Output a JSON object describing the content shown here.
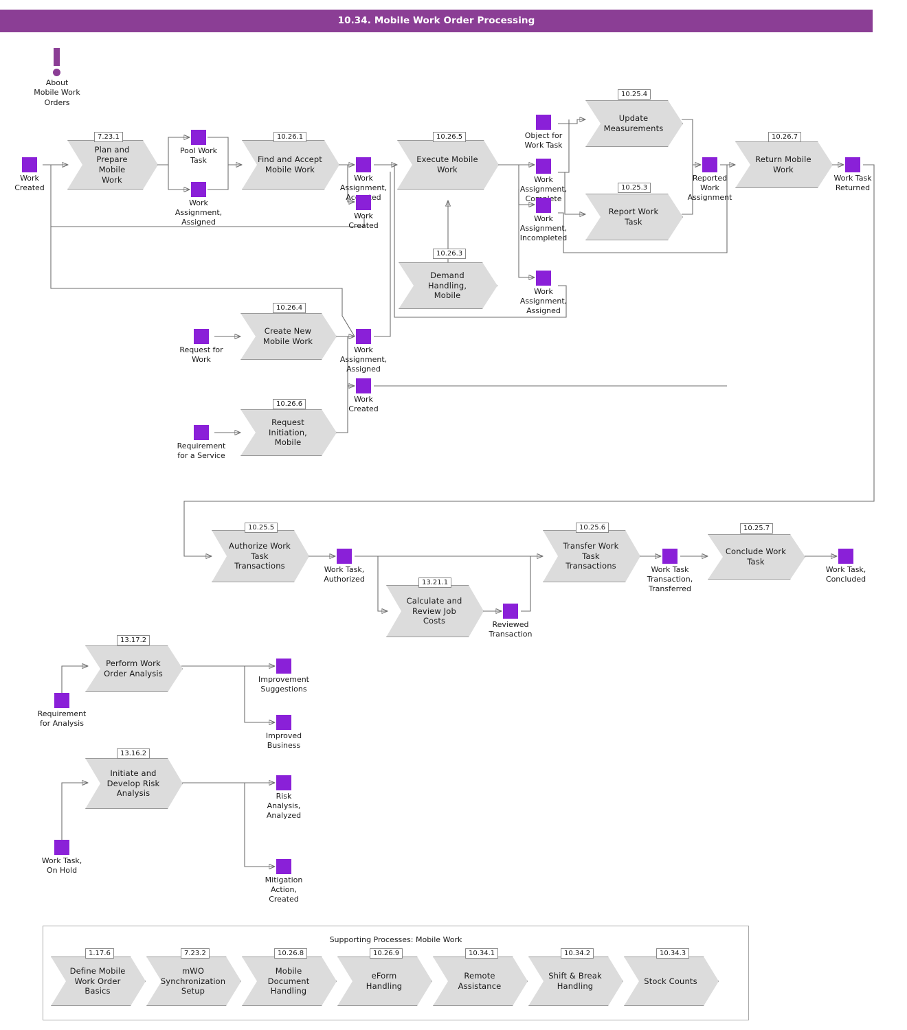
{
  "header": {
    "title": "10.34. Mobile Work Order Processing",
    "bg": "#8B3E95"
  },
  "colors": {
    "state": "#8A20D8",
    "process_fill": "#DCDCDC",
    "process_border": "#9a9a9a",
    "wire": "#6e6e6e"
  },
  "note": {
    "label": "About\nMobile Work\nOrders",
    "line1": "About",
    "line2": "Mobile Work",
    "line3": "Orders"
  },
  "processes": [
    {
      "id": "plan",
      "num": "7.23.1",
      "label": "Plan and\nPrepare Mobile\nWork"
    },
    {
      "id": "find",
      "num": "10.26.1",
      "label": "Find and Accept\nMobile Work"
    },
    {
      "id": "execute",
      "num": "10.26.5",
      "label": "Execute Mobile\nWork"
    },
    {
      "id": "update",
      "num": "10.25.4",
      "label": "Update\nMeasurements"
    },
    {
      "id": "report",
      "num": "10.25.3",
      "label": "Report Work\nTask"
    },
    {
      "id": "return",
      "num": "10.26.7",
      "label": "Return Mobile\nWork"
    },
    {
      "id": "demand",
      "num": "10.26.3",
      "label": "Demand\nHandling, Mobile"
    },
    {
      "id": "createnew",
      "num": "10.26.4",
      "label": "Create New\nMobile Work"
    },
    {
      "id": "reqinit",
      "num": "10.26.6",
      "label": "Request\nInitiation, Mobile"
    },
    {
      "id": "authorize",
      "num": "10.25.5",
      "label": "Authorize Work\nTask\nTransactions"
    },
    {
      "id": "calcjob",
      "num": "13.21.1",
      "label": "Calculate and\nReview Job\nCosts"
    },
    {
      "id": "transfer",
      "num": "10.25.6",
      "label": "Transfer Work\nTask\nTransactions"
    },
    {
      "id": "conclude",
      "num": "10.25.7",
      "label": "Conclude Work\nTask"
    },
    {
      "id": "perform",
      "num": "13.17.2",
      "label": "Perform Work\nOrder Analysis"
    },
    {
      "id": "risk",
      "num": "13.16.2",
      "label": "Initiate and\nDevelop Risk\nAnalysis"
    }
  ],
  "states": [
    {
      "id": "work-created",
      "label": "Work\nCreated"
    },
    {
      "id": "pool-work-task",
      "label": "Pool Work\nTask"
    },
    {
      "id": "wa-assigned-1",
      "label": "Work\nAssignment,\nAssigned"
    },
    {
      "id": "wa-accepted",
      "label": "Work\nAssignment,\nAccepted"
    },
    {
      "id": "work-created-2",
      "label": "Work\nCreated"
    },
    {
      "id": "object-for-work-task",
      "label": "Object for\nWork Task"
    },
    {
      "id": "wa-complete",
      "label": "Work\nAssignment,\nComplete"
    },
    {
      "id": "wa-incompleted",
      "label": "Work\nAssignment,\nIncompleted"
    },
    {
      "id": "wa-assigned-2",
      "label": "Work\nAssignment,\nAssigned"
    },
    {
      "id": "reported-work-assignment",
      "label": "Reported\nWork\nAssignment"
    },
    {
      "id": "work-task-returned",
      "label": "Work Task\nReturned"
    },
    {
      "id": "request-for-work",
      "label": "Request for\nWork"
    },
    {
      "id": "wa-assigned-3",
      "label": "Work\nAssignment,\nAssigned"
    },
    {
      "id": "work-created-3",
      "label": "Work\nCreated"
    },
    {
      "id": "requirement-service",
      "label": "Requirement\nfor a Service"
    },
    {
      "id": "work-task-authorized",
      "label": "Work Task,\nAuthorized"
    },
    {
      "id": "reviewed-transaction",
      "label": "Reviewed\nTransaction"
    },
    {
      "id": "wtt-transferred",
      "label": "Work Task\nTransaction,\nTransferred"
    },
    {
      "id": "work-task-concluded",
      "label": "Work Task,\nConcluded"
    },
    {
      "id": "requirement-analysis",
      "label": "Requirement\nfor Analysis"
    },
    {
      "id": "improvement-suggestions",
      "label": "Improvement\nSuggestions"
    },
    {
      "id": "improved-business",
      "label": "Improved\nBusiness"
    },
    {
      "id": "work-task-on-hold",
      "label": "Work Task,\nOn Hold"
    },
    {
      "id": "risk-analysis-analyzed",
      "label": "Risk\nAnalysis,\nAnalyzed"
    },
    {
      "id": "mitigation-action",
      "label": "Mitigation\nAction,\nCreated"
    }
  ],
  "supporting": {
    "title": "Supporting Processes: Mobile Work",
    "items": [
      {
        "num": "1.17.6",
        "label": "Define Mobile\nWork Order\nBasics"
      },
      {
        "num": "7.23.2",
        "label": "mWO\nSynchronization\nSetup"
      },
      {
        "num": "10.26.8",
        "label": "Mobile\nDocument\nHandling"
      },
      {
        "num": "10.26.9",
        "label": "eForm Handling"
      },
      {
        "num": "10.34.1",
        "label": "Remote\nAssistance"
      },
      {
        "num": "10.34.2",
        "label": "Shift & Break\nHandling"
      },
      {
        "num": "10.34.3",
        "label": "Stock Counts"
      }
    ]
  }
}
